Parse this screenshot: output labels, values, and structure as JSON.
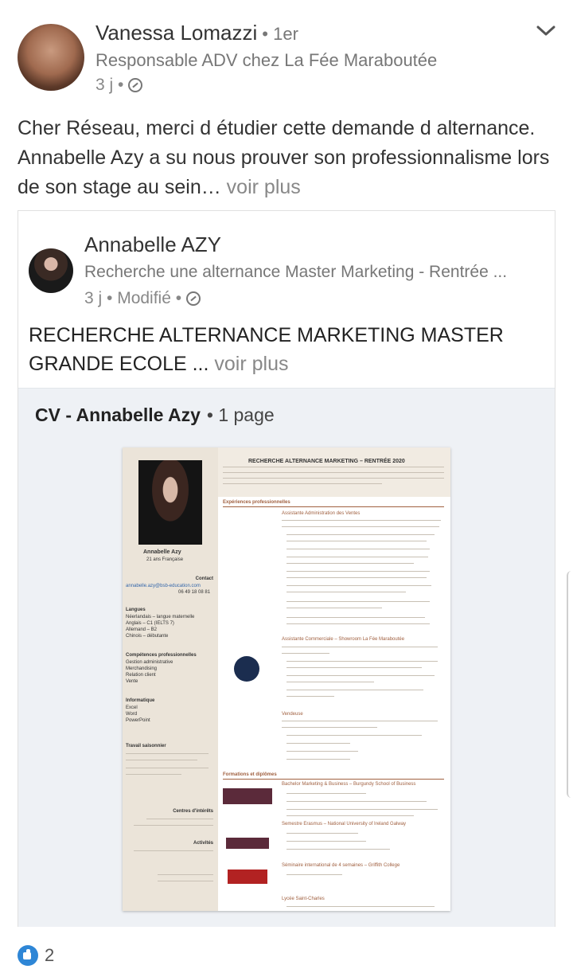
{
  "post": {
    "author": {
      "name": "Vanessa Lomazzi",
      "degree": "• 1er",
      "headline": "Responsable ADV chez La Fée Maraboutée",
      "time": "3 j •"
    },
    "text": "Cher Réseau, merci d étudier cette demande d alternance. Annabelle Azy a su nous prouver son professionnalisme lors de son stage au sein…",
    "see_more": " voir plus"
  },
  "shared": {
    "author": {
      "name": "Annabelle AZY",
      "headline": "Recherche une alternance Master Marketing - Rentrée ...",
      "time": "3 j • Modifié •"
    },
    "text": "RECHERCHE ALTERNANCE MARKETING MASTER GRANDE ECOLE ...",
    "see_more": " voir plus",
    "document": {
      "title": "CV - Annabelle Azy",
      "pages": "• 1 page"
    }
  },
  "cv": {
    "heading": "RECHERCHE ALTERNANCE MARKETING – RENTRÉE 2020",
    "name": "Annabelle Azy",
    "age": "21 ans Française",
    "contact_label": "Contact",
    "email": "annabelle.azy@bsb-education.com",
    "phone": "06 49 18 08 81",
    "langues_label": "Langues",
    "langues": [
      "Néerlandais – langue maternelle",
      "Anglais – C1 (IELTS 7)",
      "Allemand – B2",
      "Chinois – débutante"
    ],
    "competences_label": "Compétences professionnelles",
    "competences": [
      "Gestion administrative",
      "Merchandising",
      "Relation client",
      "Vente"
    ],
    "informatique_label": "Informatique",
    "informatique": [
      "Excel",
      "Word",
      "PowerPoint"
    ],
    "travail_label": "Travail saisonnier",
    "centres_label": "Centres d'intérêts",
    "activites_label": "Activités",
    "experiences_label": "Expériences professionnelles",
    "exp1_title": "Assistante Administration des Ventes",
    "exp2_title": "Assistante Commerciale – Showroom La Fée Maraboutée",
    "exp3_title": "Vendeuse",
    "formations_label": "Formations et diplômes",
    "form1_title": "Bachelor Marketing & Business – Burgundy School of Business",
    "form2_title": "Semestre Erasmus – National University of Ireland Galway",
    "form3_title": "Séminaire international de 4 semaines – Griffith College",
    "form4_title": "Lycée Saint-Charles"
  },
  "reactions": {
    "count": "2"
  },
  "colors": {
    "like_blue": "#2e86d6",
    "cv_sidebar": "#ebe4d9",
    "cv_accent": "#a06040"
  },
  "icons": [
    "globe-icon",
    "chevron-down-icon",
    "like-icon"
  ]
}
